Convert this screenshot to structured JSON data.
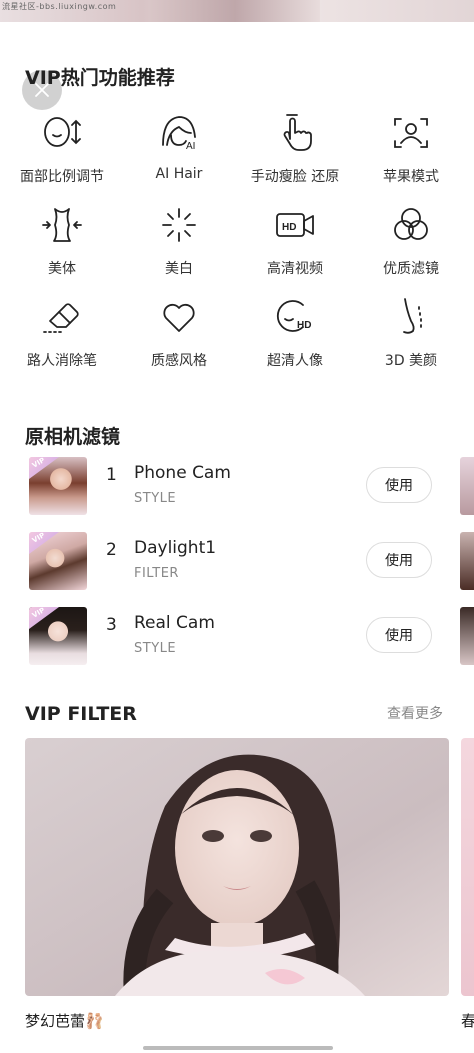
{
  "watermark": "流星社区-bbs.liuxingw.com",
  "vip_features": {
    "title": "VIP热门功能推荐",
    "items": [
      {
        "label": "面部比例调节",
        "icon": "face-ratio-icon"
      },
      {
        "label": "AI Hair",
        "icon": "ai-hair-icon"
      },
      {
        "label": "手动瘦脸 还原",
        "icon": "manual-slim-face-icon"
      },
      {
        "label": "苹果模式",
        "icon": "apple-mode-icon"
      },
      {
        "label": "美体",
        "icon": "body-shape-icon"
      },
      {
        "label": "美白",
        "icon": "whitening-icon"
      },
      {
        "label": "高清视频",
        "icon": "hd-video-icon"
      },
      {
        "label": "优质滤镜",
        "icon": "premium-filter-icon"
      },
      {
        "label": "路人消除笔",
        "icon": "eraser-icon"
      },
      {
        "label": "质感风格",
        "icon": "heart-texture-icon"
      },
      {
        "label": "超清人像",
        "icon": "hd-portrait-icon"
      },
      {
        "label": "3D 美颜",
        "icon": "3d-nose-icon"
      }
    ]
  },
  "camera_filters": {
    "title": "原相机滤镜",
    "vip_tag": "VIP",
    "button_label": "使用",
    "rows": [
      {
        "rank": "1",
        "name": "Phone Cam",
        "type": "STYLE"
      },
      {
        "rank": "2",
        "name": "Daylight1",
        "type": "FILTER"
      },
      {
        "rank": "3",
        "name": "Real Cam",
        "type": "STYLE"
      }
    ]
  },
  "vip_filter": {
    "title": "VIP FILTER",
    "more_label": "查看更多",
    "cards": [
      {
        "label": "梦幻芭蕾🩰"
      },
      {
        "label": "春"
      }
    ]
  },
  "colors": {
    "text_primary": "#222222",
    "text_secondary": "#888888",
    "button_border": "#dddddd"
  }
}
